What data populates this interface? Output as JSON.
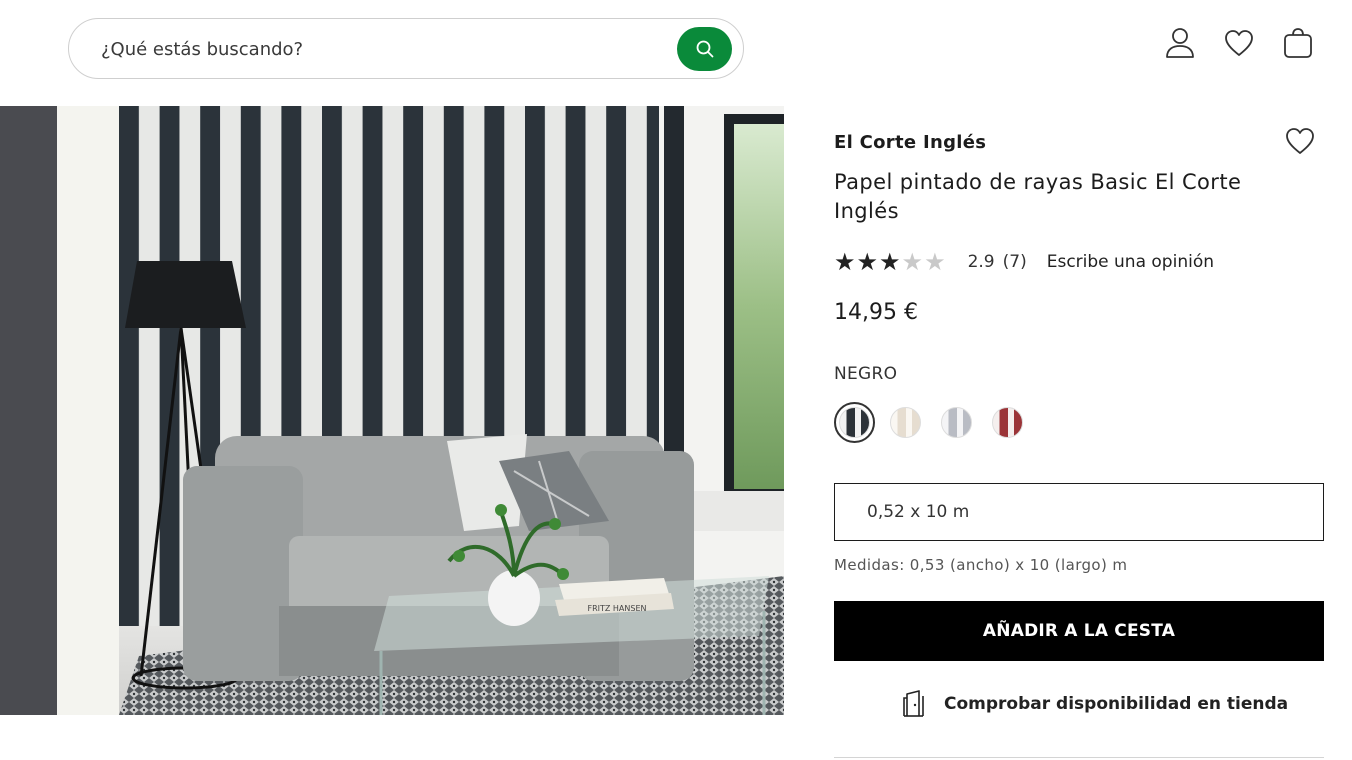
{
  "header": {
    "search_placeholder": "¿Qué estás buscando?",
    "icons": [
      "search-icon",
      "user-icon",
      "heart-icon",
      "bag-icon"
    ],
    "accent_color": "#0a8a3a"
  },
  "product": {
    "brand": "El Corte Inglés",
    "title": "Papel pintado de rayas Basic El Corte Inglés",
    "rating": {
      "stars_filled": 3,
      "stars_total": 5,
      "value": "2.9",
      "count": "(7)",
      "write_review_label": "Escribe una opinión"
    },
    "price": "14,95 €",
    "color": {
      "label": "NEGRO",
      "options": [
        {
          "name": "negro",
          "colors": [
            "#2c3238",
            "#f2f2f2"
          ],
          "selected": true
        },
        {
          "name": "beige",
          "colors": [
            "#e6ddd0",
            "#faf7f2"
          ],
          "selected": false
        },
        {
          "name": "gris",
          "colors": [
            "#b9bcc4",
            "#f4f4f6"
          ],
          "selected": false
        },
        {
          "name": "rojo",
          "colors": [
            "#9b3438",
            "#f5efee"
          ],
          "selected": false
        }
      ]
    },
    "size": {
      "selected": "0,52 x 10 m"
    },
    "measures": "Medidas: 0,53 (ancho) x 10 (largo) m",
    "add_to_cart_label": "AÑADIR A LA CESTA",
    "store_check_label": "Comprobar disponibilidad en tienda",
    "image_caption_text": "FRITZ HANSEN"
  }
}
